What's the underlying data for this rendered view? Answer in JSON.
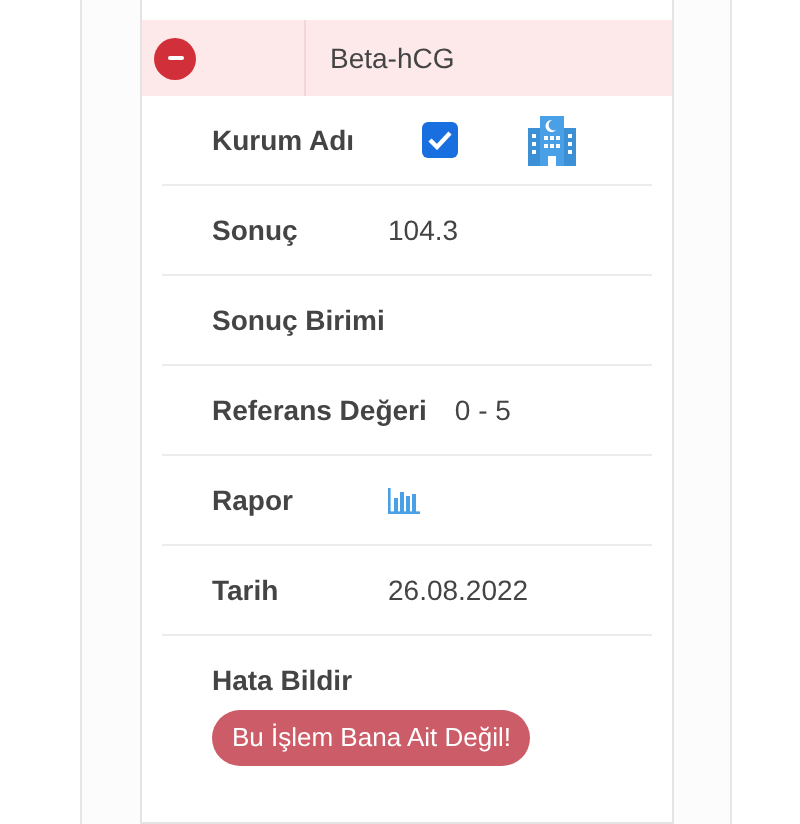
{
  "record": {
    "title": "Beta-hCG",
    "expanded": true
  },
  "fields": [
    {
      "kind": "checkbox",
      "label": "Kurum Adı",
      "checked": true
    },
    {
      "kind": "text",
      "label": "Sonuç",
      "value": "104.3"
    },
    {
      "kind": "text",
      "label": "Sonuç Birimi"
    },
    {
      "kind": "text",
      "label": "Referans Değeri",
      "value": "0 - 5"
    },
    {
      "kind": "report",
      "label": "Rapor"
    },
    {
      "kind": "text",
      "label": "Tarih",
      "value": "26.08.2022"
    }
  ],
  "report_error": {
    "label": "Hata Bildir",
    "button": "Bu İşlem Bana Ait Değil!"
  }
}
